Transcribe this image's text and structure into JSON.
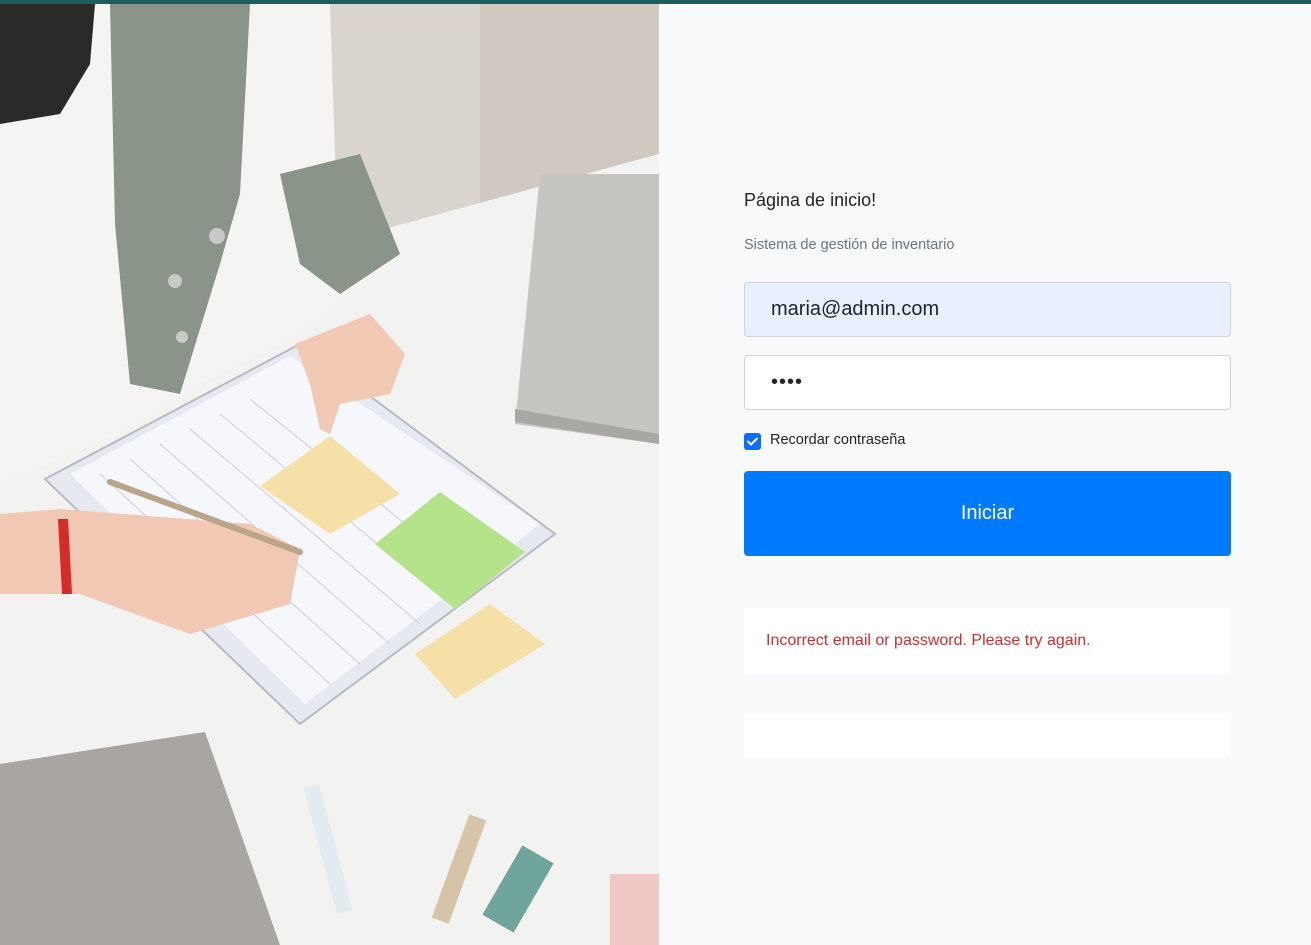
{
  "colors": {
    "accent": "#007bff",
    "topbar": "#1a5e5e",
    "error": "#c53030",
    "checkbox": "#0d6efd"
  },
  "hero": {
    "image_subject": "person-writing-on-notebook-with-sticky-notes"
  },
  "login": {
    "title": "Página de inicio!",
    "subtitle": "Sistema de gestión de inventario",
    "email_value": "maria@admin.com",
    "password_value": "••••",
    "remember_label": "Recordar contraseña",
    "remember_checked": true,
    "submit_label": "Iniciar",
    "error_message": "Incorrect email or password. Please try again."
  }
}
